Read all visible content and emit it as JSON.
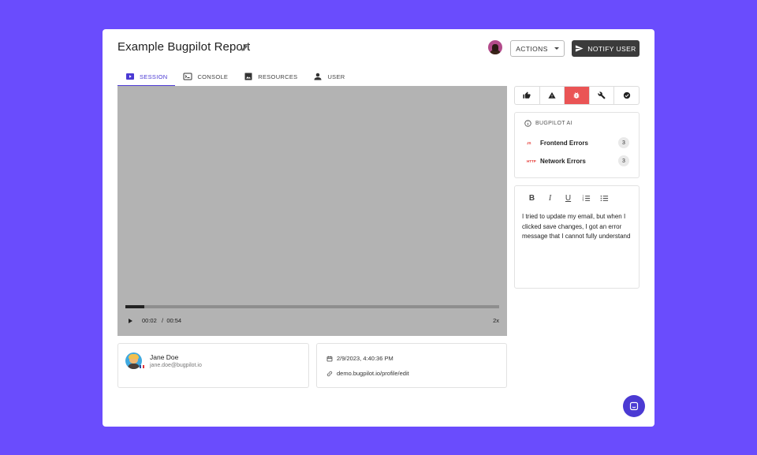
{
  "report": {
    "title": "Example Bugpilot Report",
    "actions_label": "ACTIONS",
    "notify_label": "NOTIFY USER"
  },
  "tabs": [
    {
      "label": "SESSION",
      "icon": "play-icon",
      "active": true
    },
    {
      "label": "CONSOLE",
      "icon": "terminal-icon",
      "active": false
    },
    {
      "label": "RESOURCES",
      "icon": "image-icon",
      "active": false
    },
    {
      "label": "USER",
      "icon": "person-icon",
      "active": false
    }
  ],
  "player": {
    "current_time": "00:02",
    "separator": "/",
    "duration": "00:54",
    "speed": "2x",
    "progress_fraction": 0.05
  },
  "user": {
    "name": "Jane Doe",
    "email": "jane.doe@bugpilot.io"
  },
  "meta": {
    "timestamp": "2/9/2023, 4:40:36 PM",
    "url": "demo.bugpilot.io/profile/edit"
  },
  "toolbar": {
    "icons": [
      "thumbs-up-icon",
      "warning-icon",
      "bug-icon",
      "wrench-icon",
      "check-circle-icon"
    ],
    "active_index": 2,
    "active_color": "#ea5455"
  },
  "ai": {
    "heading": "BUGPILOT AI",
    "errors": [
      {
        "tag": "JS",
        "label": "Frontend Errors",
        "count": "3"
      },
      {
        "tag": "HTTP",
        "label": "Network Errors",
        "count": "3"
      }
    ]
  },
  "note": {
    "text": "I tried to update my email, but when I clicked save changes, I got an error message that I cannot fully understand"
  },
  "colors": {
    "background": "#6a4cfd",
    "accent": "#4b3ad3"
  }
}
